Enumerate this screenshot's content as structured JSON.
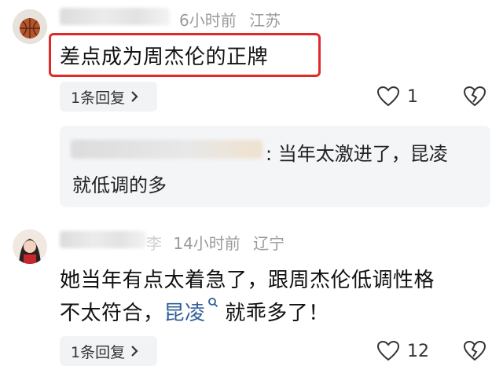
{
  "comments": [
    {
      "time": "6小时前",
      "location": "江苏",
      "text": "差点成为周杰伦的正牌",
      "reply_button": "1条回复",
      "like_count": "1",
      "reply": {
        "text_line1": ": 当年太激进了，昆凌",
        "text_line2": "就低调的多"
      }
    },
    {
      "name_suffix": "李",
      "time": "14小时前",
      "location": "辽宁",
      "text_line1": "她当年有点太着急了，跟周杰伦低调性格",
      "text_line2_prefix": "不太符合，",
      "text_line2_link": "昆凌",
      "text_line2_suffix": " 就乖多了！",
      "reply_button": "1条回复",
      "like_count": "12"
    }
  ],
  "colors": {
    "highlight": "#e02a2a",
    "link": "#2f5d99",
    "meta": "#9a9a9a"
  }
}
